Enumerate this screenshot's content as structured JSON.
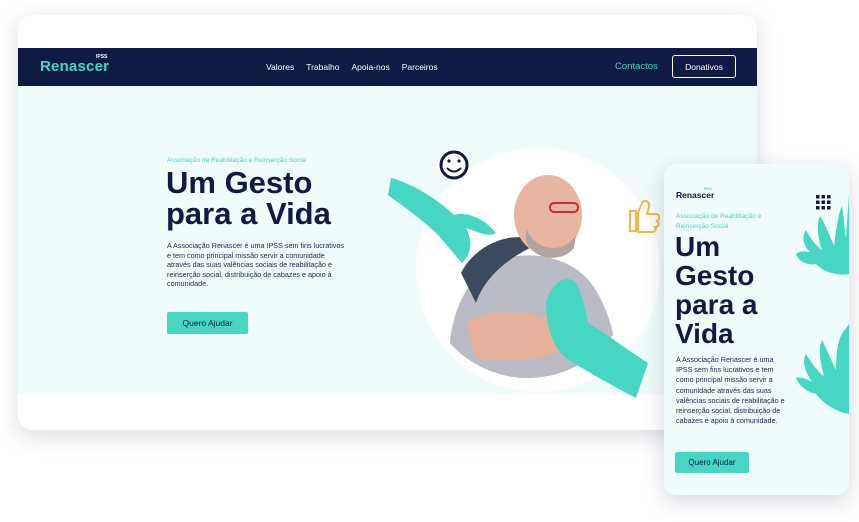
{
  "desktop": {
    "nav": {
      "logo": "Renascer",
      "logo_sup": "IPSS",
      "menu": [
        "Valores",
        "Trabalho",
        "Apoia-nos",
        "Parceiros"
      ],
      "contact": "Contactos",
      "donate": "Donativos"
    },
    "hero": {
      "tagline": "Associação de Reabilitação e Reinserção Social",
      "title": "Um Gesto para a Vida",
      "body": "A Associação Renascer é uma IPSS sem fins lucrativos e tem como principal missão servir a comunidade através das suas valências sociais de reabilitação e reinserção social, distribuição de cabazes e apoio à comunidade.",
      "cta": "Quero Ajudar"
    }
  },
  "mobile": {
    "logo": "Renascer",
    "logo_sup": "IPSS",
    "tagline": "Associação de Reabilitação e Reinserção Social",
    "title": "Um Gesto para a Vida",
    "body": "A Associação Renascer é uma IPSS sem fins lucrativos e tem como principal missão servir a comunidade através das suas valências sociais de reabilitação e reinserção social, distribuição de cabazes e apoio à comunidade.",
    "cta": "Quero Ajudar"
  },
  "colors": {
    "navy": "#0f1b45",
    "teal": "#46d6c1",
    "hero_bg": "#f0fbfb",
    "accent_yellow": "#f5b844"
  },
  "icons": [
    "smiley-icon",
    "thumbs-up-icon",
    "grid-menu-icon",
    "hand-illustration"
  ]
}
